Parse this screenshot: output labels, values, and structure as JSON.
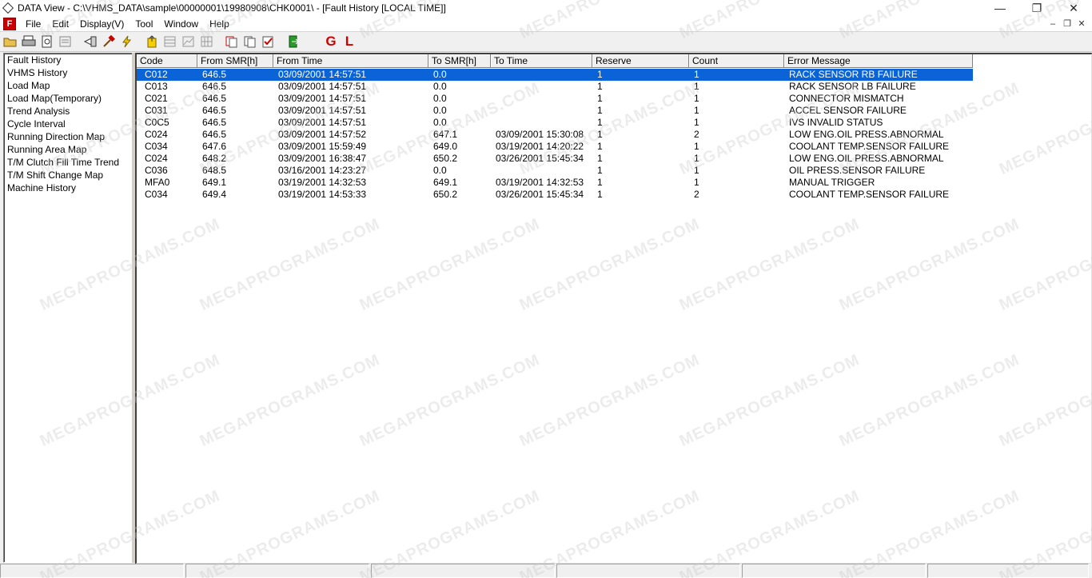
{
  "window": {
    "title": "DATA View - C:\\VHMS_DATA\\sample\\00000001\\19980908\\CHK0001\\ - [Fault History   [LOCAL TIME]]",
    "controls": {
      "minimize": "—",
      "maximize": "❐",
      "close": "✕"
    }
  },
  "menu": {
    "logo": "F",
    "items": [
      "File",
      "Edit",
      "Display(V)",
      "Tool",
      "Window",
      "Help"
    ],
    "mdi": {
      "minimize": "–",
      "restore": "❐",
      "close": "✕"
    }
  },
  "toolbar": {
    "g_label": "G",
    "l_label": "L"
  },
  "sidebar": {
    "items": [
      "Fault History",
      "VHMS History",
      "Load Map",
      "Load Map(Temporary)",
      "Trend Analysis",
      "Cycle Interval",
      "Running Direction Map",
      "Running Area Map",
      "T/M Clutch Fill Time Trend",
      "T/M Shift Change Map",
      "Machine History"
    ]
  },
  "grid": {
    "columns": [
      "Code",
      "From SMR[h]",
      "From Time",
      "To SMR[h]",
      "To Time",
      "Reserve",
      "Count",
      "Error Message"
    ],
    "rows": [
      [
        "C012",
        "646.5",
        "03/09/2001 14:57:51",
        "0.0",
        "",
        "1",
        "1",
        "RACK SENSOR RB FAILURE"
      ],
      [
        "C013",
        "646.5",
        "03/09/2001 14:57:51",
        "0.0",
        "",
        "1",
        "1",
        "RACK SENSOR LB FAILURE"
      ],
      [
        "C021",
        "646.5",
        "03/09/2001 14:57:51",
        "0.0",
        "",
        "1",
        "1",
        "CONNECTOR MISMATCH"
      ],
      [
        "C031",
        "646.5",
        "03/09/2001 14:57:51",
        "0.0",
        "",
        "1",
        "1",
        "ACCEL SENSOR FAILURE"
      ],
      [
        "C0C5",
        "646.5",
        "03/09/2001 14:57:51",
        "0.0",
        "",
        "1",
        "1",
        "IVS INVALID STATUS"
      ],
      [
        "C024",
        "646.5",
        "03/09/2001 14:57:52",
        "647.1",
        "03/09/2001 15:30:08",
        "1",
        "2",
        "LOW ENG.OIL PRESS.ABNORMAL"
      ],
      [
        "C034",
        "647.6",
        "03/09/2001 15:59:49",
        "649.0",
        "03/19/2001 14:20:22",
        "1",
        "1",
        "COOLANT TEMP.SENSOR FAILURE"
      ],
      [
        "C024",
        "648.2",
        "03/09/2001 16:38:47",
        "650.2",
        "03/26/2001 15:45:34",
        "1",
        "1",
        "LOW ENG.OIL PRESS.ABNORMAL"
      ],
      [
        "C036",
        "648.5",
        "03/16/2001 14:23:27",
        "0.0",
        "",
        "1",
        "1",
        "OIL PRESS.SENSOR FAILURE"
      ],
      [
        "MFA0",
        "649.1",
        "03/19/2001 14:32:53",
        "649.1",
        "03/19/2001 14:32:53",
        "1",
        "1",
        "MANUAL TRIGGER"
      ],
      [
        "C034",
        "649.4",
        "03/19/2001 14:53:33",
        "650.2",
        "03/26/2001 15:45:34",
        "1",
        "2",
        "COOLANT TEMP.SENSOR FAILURE"
      ]
    ],
    "selected_row": 0
  },
  "watermark": {
    "text": "MEGAPROGRAMS.COM"
  }
}
